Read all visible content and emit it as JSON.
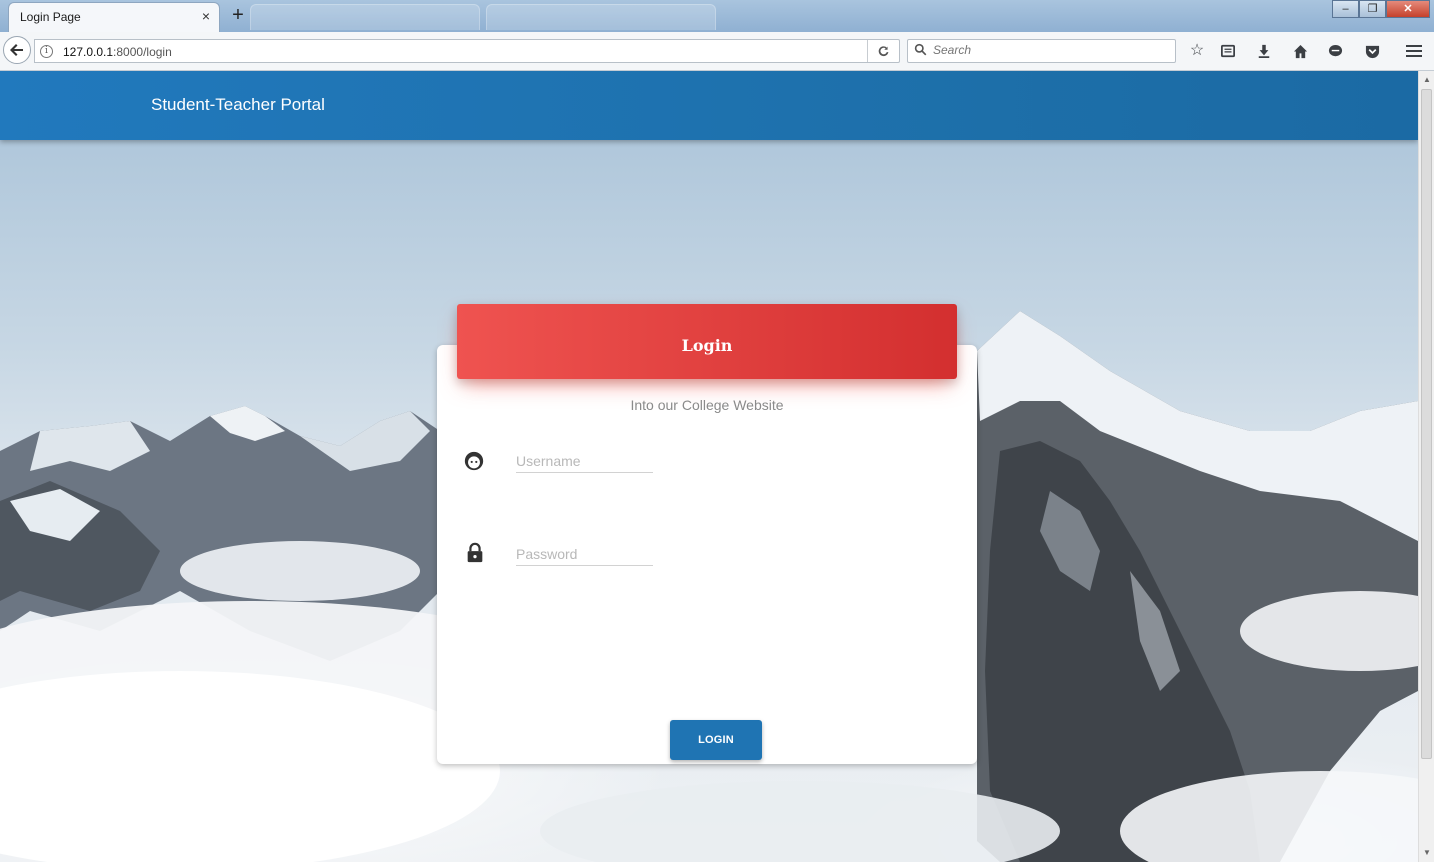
{
  "browser": {
    "tab_title": "Login Page",
    "tab_close": "×",
    "new_tab": "+",
    "url_host": "127.0.0.1",
    "url_rest": ":8000/login",
    "search_placeholder": "Search",
    "window_buttons": {
      "minimize": "–",
      "restore": "❐",
      "close": "✕"
    },
    "toolbar_icons": [
      "bookmark-star-icon",
      "reading-list-icon",
      "download-icon",
      "home-icon",
      "chat-icon",
      "pocket-icon",
      "menu-icon"
    ]
  },
  "navbar": {
    "brand": "Student-Teacher Portal"
  },
  "login_card": {
    "title": "Login",
    "subtitle": "Into our College Website",
    "username_placeholder": "Username",
    "password_placeholder": "Password",
    "submit_label": "LOGIN"
  },
  "colors": {
    "navbar": "#1f74b3",
    "header_start": "#ef5350",
    "header_end": "#d32f2f",
    "button": "#1f74b3"
  }
}
